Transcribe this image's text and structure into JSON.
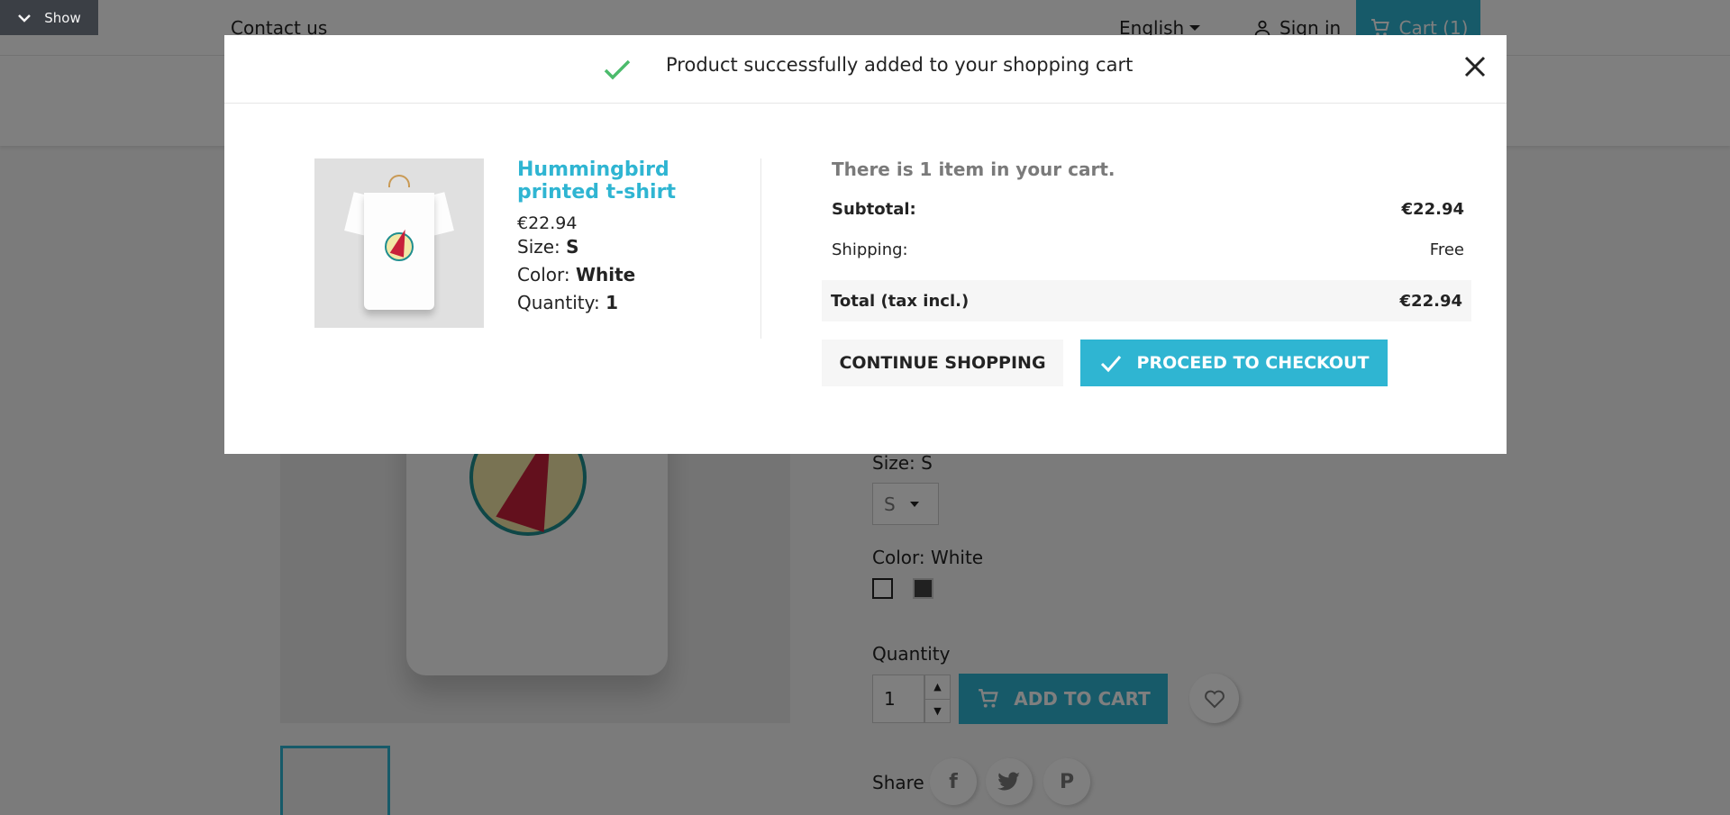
{
  "debug_toggle": {
    "label": "Show",
    "icon": "chevron-down-icon"
  },
  "header": {
    "contact_label": "Contact us",
    "language_label": "English",
    "signin_label": "Sign in",
    "cart_label": "Cart (1)"
  },
  "product_page": {
    "size_label": "Size: S",
    "size_value": "S",
    "color_label": "Color: White",
    "quantity_label": "Quantity",
    "quantity_value": "1",
    "add_to_cart_label": "ADD TO CART",
    "share_label": "Share",
    "social_icons": [
      "facebook-icon",
      "twitter-icon",
      "pinterest-icon"
    ],
    "accent_color": "#2fb5d2"
  },
  "modal": {
    "title": "Product successfully added to your shopping cart",
    "success_color": "#4cbb6c",
    "product": {
      "name": "Hummingbird printed t-shirt",
      "price": "€22.94",
      "size_key": "Size:",
      "size_value": "S",
      "color_key": "Color:",
      "color_value": "White",
      "quantity_key": "Quantity:",
      "quantity_value": "1"
    },
    "cart": {
      "count_text": "There is 1 item in your cart.",
      "subtotal_label": "Subtotal:",
      "subtotal_value": "€22.94",
      "shipping_label": "Shipping:",
      "shipping_value": "Free",
      "total_label": "Total (tax incl.)",
      "total_value": "€22.94"
    },
    "buttons": {
      "continue_label": "CONTINUE SHOPPING",
      "checkout_label": "PROCEED TO CHECKOUT"
    }
  }
}
